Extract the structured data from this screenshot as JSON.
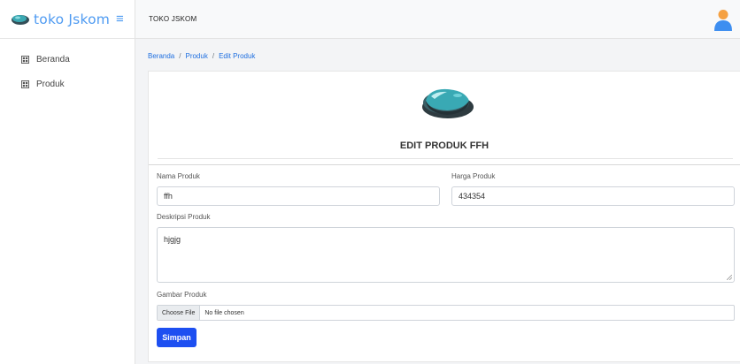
{
  "app": {
    "brand": "toko Jskom",
    "brand_icon": "mouse-logo-icon",
    "menu_icon": "hamburger-icon",
    "accent": "#4f9bf2"
  },
  "sidebar": {
    "items": [
      {
        "label": "Beranda",
        "icon": "grid-icon"
      },
      {
        "label": "Produk",
        "icon": "grid-icon"
      }
    ]
  },
  "topbar": {
    "title": "TOKO JSKOM",
    "avatar_icon": "user-avatar-icon"
  },
  "breadcrumb": [
    "Beranda",
    "Produk",
    "Edit Produk"
  ],
  "form": {
    "title": "EDIT PRODUK FFH",
    "name_label": "Nama Produk",
    "name_value": "ffh",
    "price_label": "Harga Produk",
    "price_value": "434354",
    "desc_label": "Deskripsi Produk",
    "desc_value": "hjgjg",
    "image_label": "Gambar Produk",
    "file_button": "Choose File",
    "file_status": "No file chosen",
    "submit": "Simpan",
    "submit_color": "#1d4ff1"
  }
}
